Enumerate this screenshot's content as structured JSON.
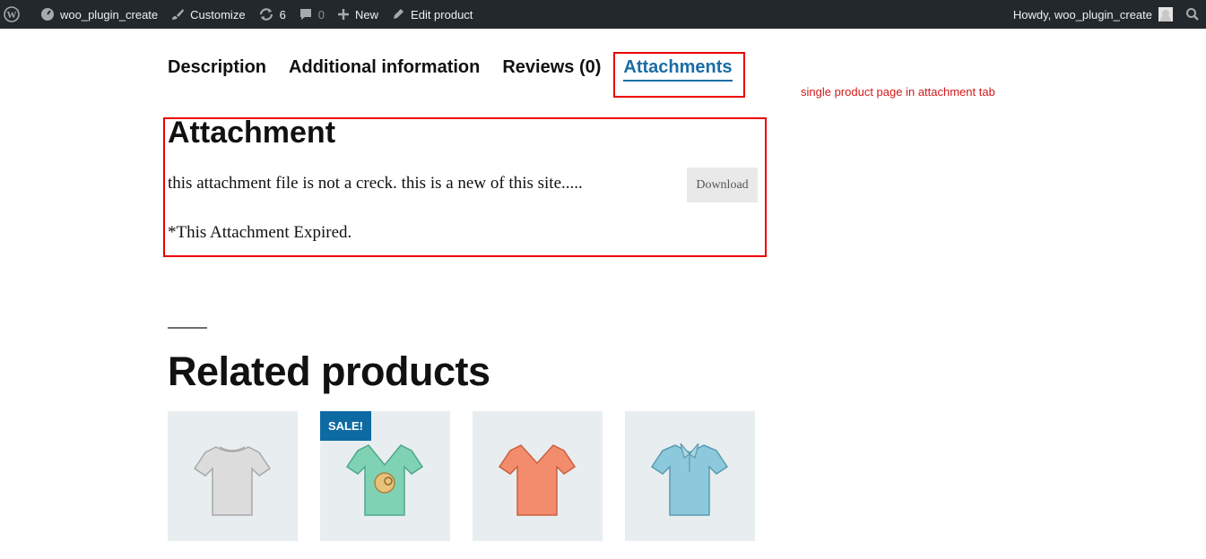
{
  "adminbar": {
    "site_name": "woo_plugin_create",
    "customize": "Customize",
    "updates_count": "6",
    "comments_count": "0",
    "new_label": "New",
    "edit_label": "Edit product",
    "howdy": "Howdy, woo_plugin_create"
  },
  "tabs": [
    {
      "label": "Description"
    },
    {
      "label": "Additional information"
    },
    {
      "label": "Reviews (0)"
    },
    {
      "label": "Attachments",
      "active": true
    }
  ],
  "annotation": "single product page in attachment tab",
  "attachment": {
    "title": "Attachment",
    "description": "this attachment file is not a creck. this is a new of this site.....",
    "download_label": "Download",
    "expired_note": "*This Attachment Expired."
  },
  "related": {
    "title": "Related products",
    "products": [
      {
        "icon": "tshirt-icon",
        "color": "#dcdcdc",
        "sale": false
      },
      {
        "icon": "vneck-logo-icon",
        "color": "#7fd3b4",
        "sale": true,
        "sale_label": "SALE!"
      },
      {
        "icon": "vneck-icon",
        "color": "#f28c6c",
        "sale": false
      },
      {
        "icon": "polo-icon",
        "color": "#8dc9dc",
        "sale": false
      }
    ]
  },
  "colors": {
    "adminbar_bg": "#23282d",
    "accent": "#1a6da5",
    "highlight": "#ee0000",
    "sale_badge": "#0e6aa3"
  }
}
